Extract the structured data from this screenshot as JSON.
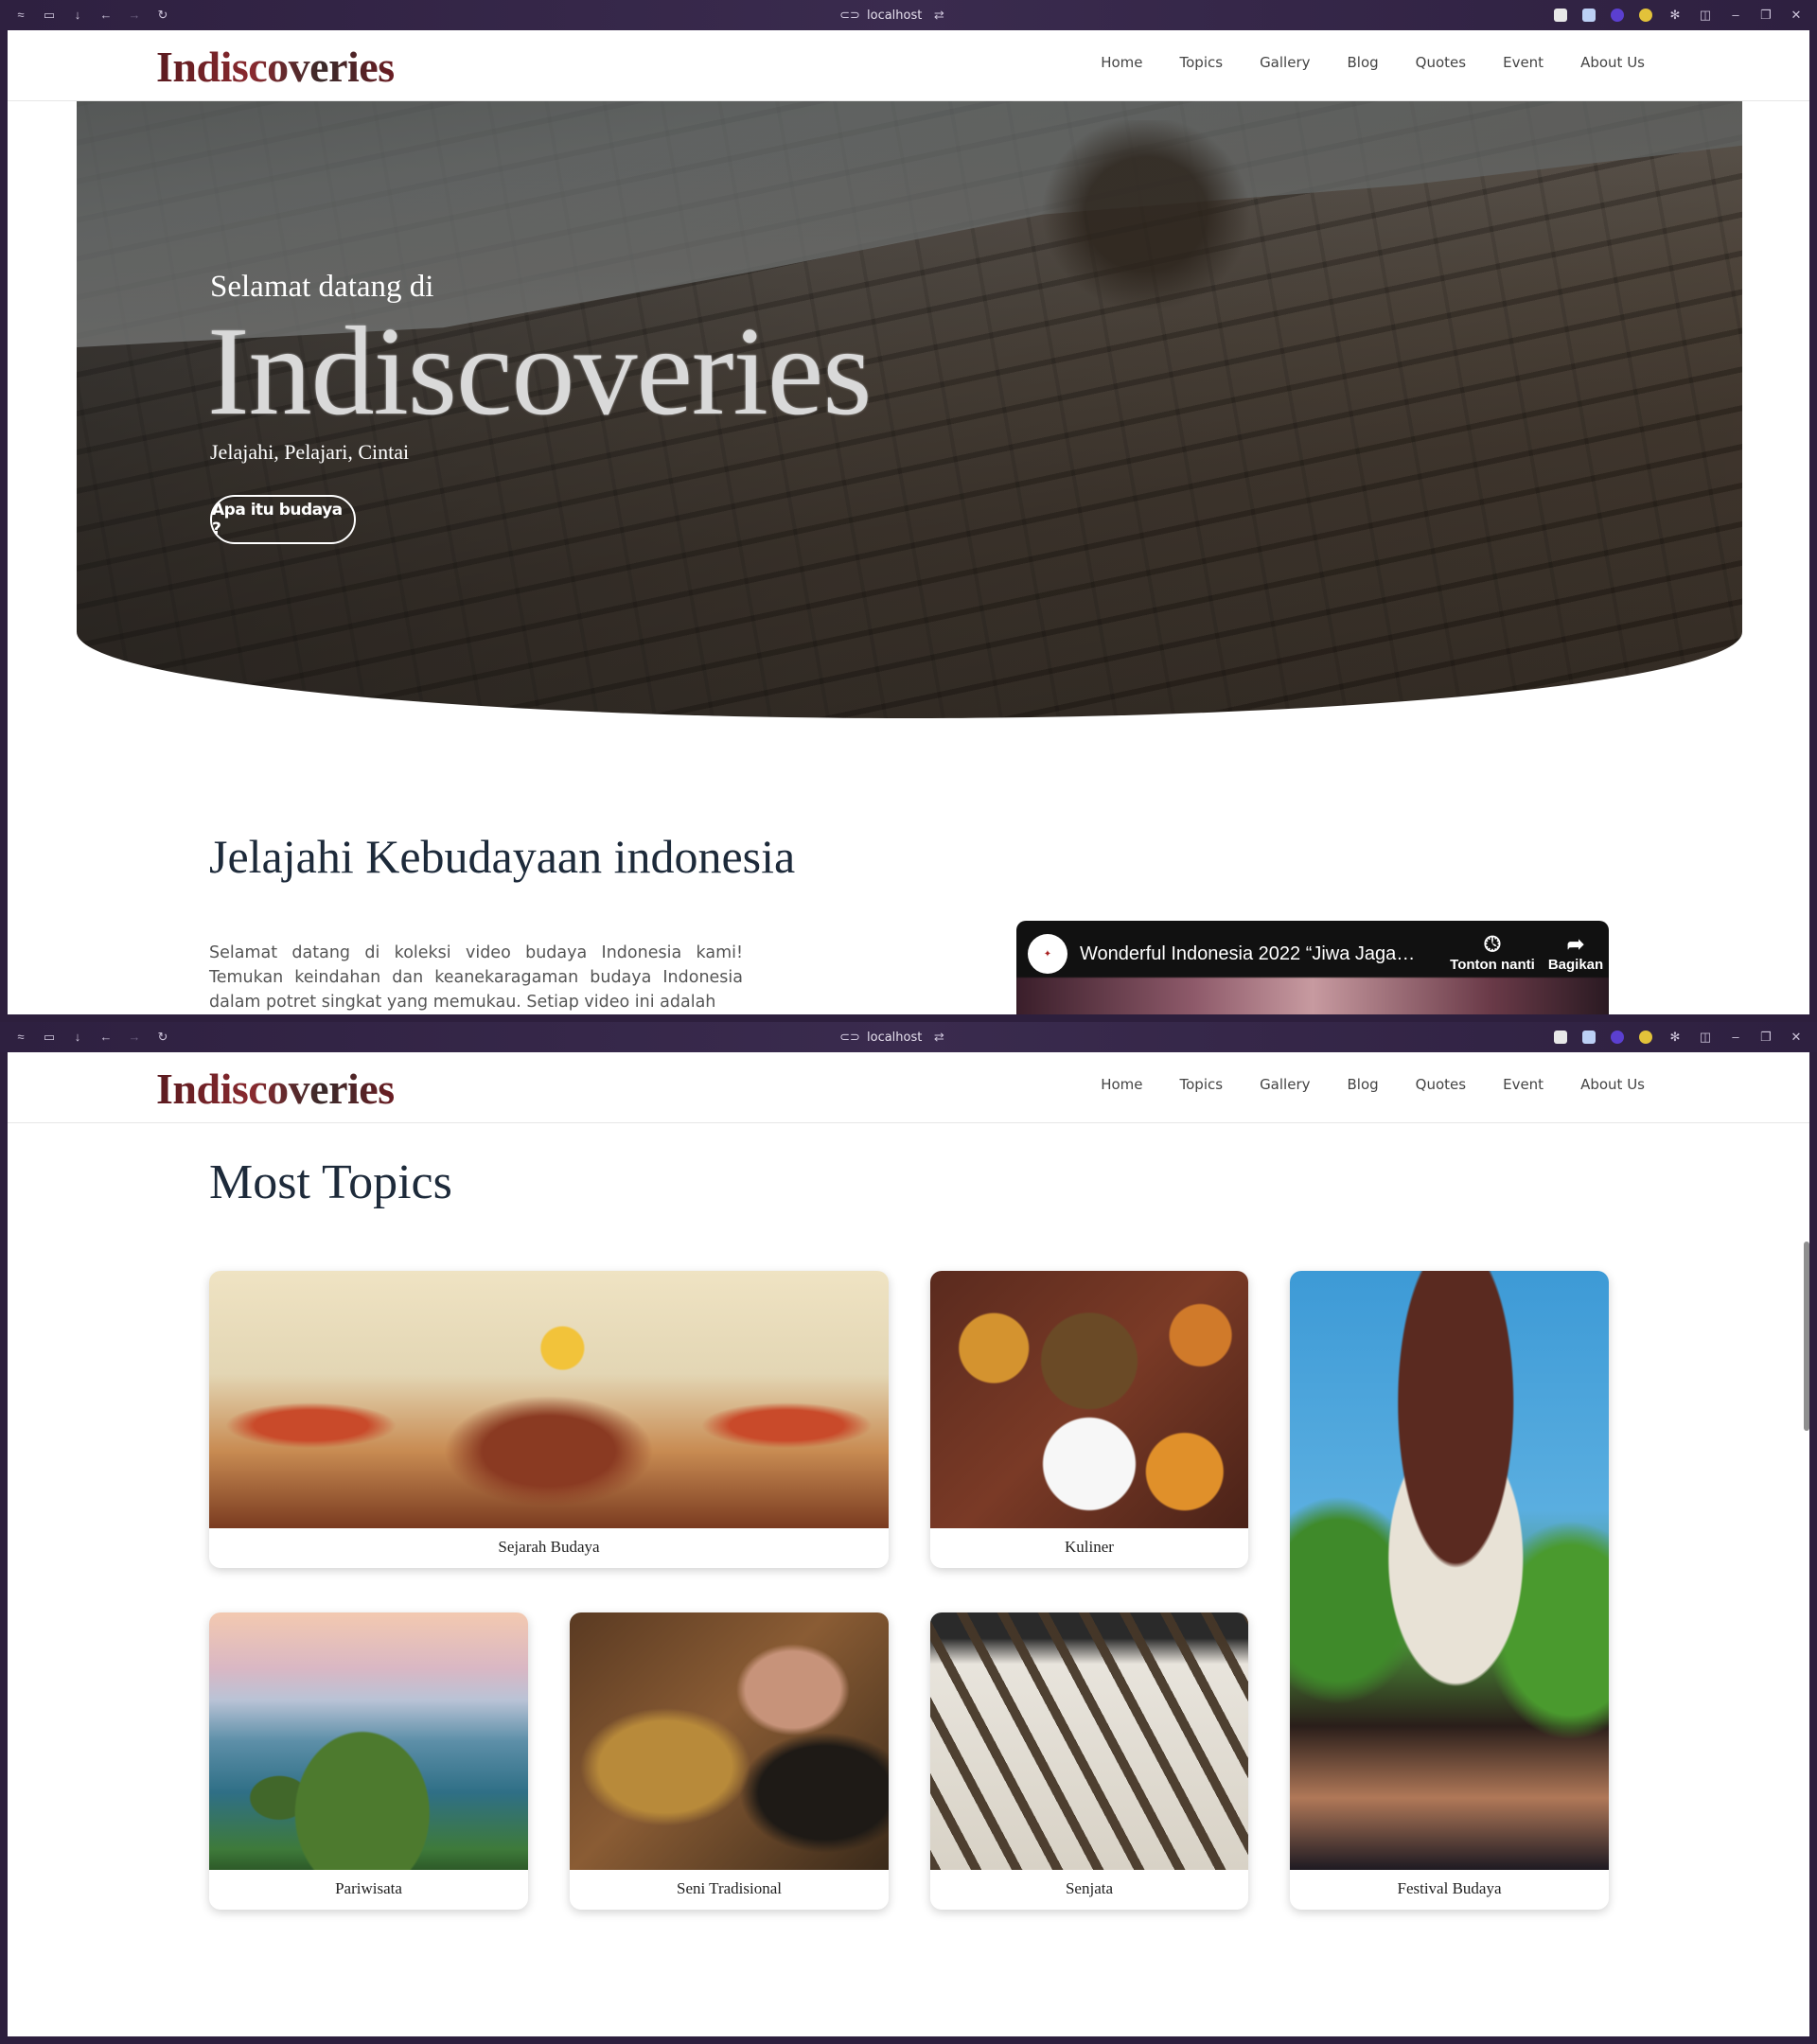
{
  "browser": {
    "url": "localhost"
  },
  "site": {
    "logo": "Indiscoveries",
    "menu": [
      "Home",
      "Topics",
      "Gallery",
      "Blog",
      "Quotes",
      "Event",
      "About Us"
    ]
  },
  "hero": {
    "subtitle": "Selamat datang di",
    "title": "Indiscoveries",
    "tagline": "Jelajahi, Pelajari, Cintai",
    "button": "Apa itu budaya ?"
  },
  "intro": {
    "heading": "Jelajahi Kebudayaan indonesia",
    "text": "Selamat datang di koleksi video budaya Indonesia kami! Temukan keindahan dan keanekaragaman budaya Indonesia dalam potret singkat yang memukau. Setiap video ini adalah",
    "video": {
      "title": "Wonderful Indonesia 2022 “Jiwa Jagad...",
      "watch_later": "Tonton nanti",
      "share": "Bagikan",
      "watch_later_icon": "clock-icon",
      "share_icon": "share-arrow-icon"
    }
  },
  "topics": {
    "heading": "Most Topics",
    "cards": [
      {
        "label": "Sejarah Budaya"
      },
      {
        "label": "Kuliner"
      },
      {
        "label": "Festival Budaya"
      },
      {
        "label": "Pariwisata"
      },
      {
        "label": "Seni Tradisional"
      },
      {
        "label": "Senjata"
      }
    ]
  },
  "colors": {
    "titlebar": "#2e2040",
    "heading": "#1d2a3a",
    "logo": "#6b1d23"
  }
}
